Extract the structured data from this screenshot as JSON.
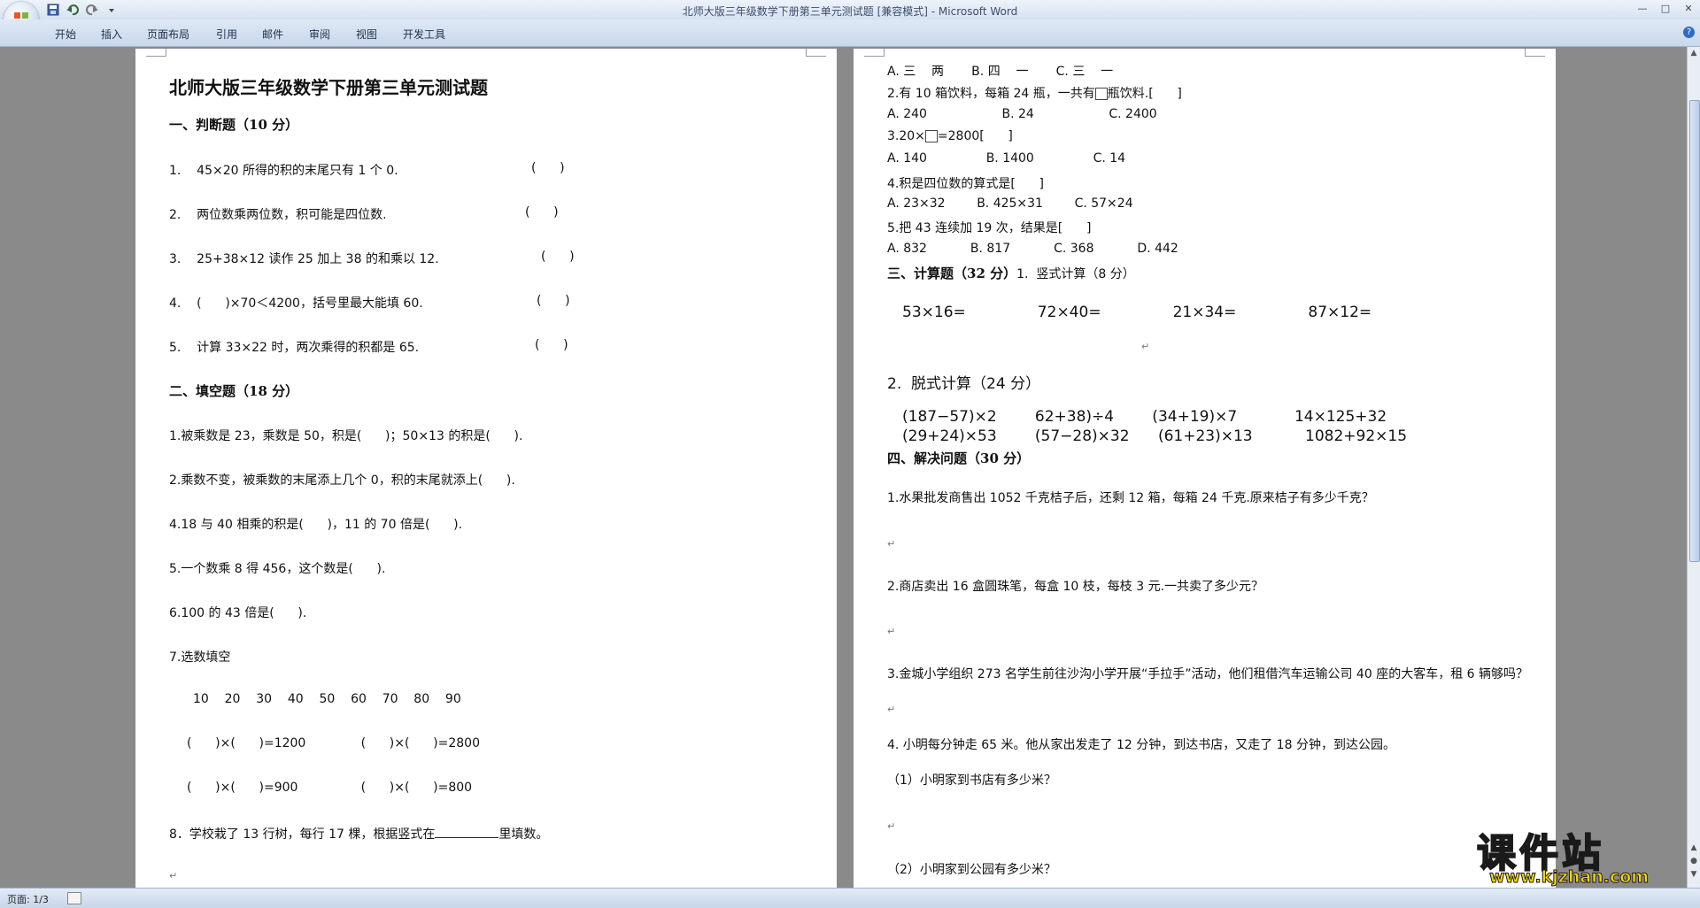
{
  "window": {
    "title": "北师大版三年级数学下册第三单元测试题 [兼容模式] - Microsoft Word",
    "controls": [
      "—",
      "□",
      "✕"
    ]
  },
  "ribbon": {
    "tabs": [
      "开始",
      "插入",
      "页面布局",
      "引用",
      "邮件",
      "审阅",
      "视图",
      "开发工具"
    ]
  },
  "status": {
    "page": "页面: 1/3"
  },
  "watermark": {
    "big": "课件站",
    "small": "www.kjzhan.com"
  },
  "page1": {
    "title": "北师大版三年级数学下册第三单元测试题",
    "s1_heading": "一、判断题（10 分）",
    "s1_items": [
      "1.    45×20 所得的积的末尾只有 1 个 0.",
      "2.    两位数乘两位数，积可能是四位数.",
      "3.    25+38×12 读作 25 加上 38 的和乘以 12.",
      "4.    (      )×70＜4200，括号里最大能填 60.",
      "5.    计算 33×22 时，两次乘得的积都是 65."
    ],
    "answer_paren": "(      )",
    "s2_heading": "二、填空题（18 分）",
    "s2_items": [
      "1.被乘数是 23，乘数是 50，积是(      )；50×13 的积是(      ).",
      "2.乘数不变，被乘数的末尾添上几个 0，积的末尾就添上(      ).",
      "4.18 与 40 相乘的积是(      )，11 的 70 倍是(      ).",
      "5.一个数乘 8 得 456，这个数是(      ).",
      "6.100 的 43 倍是(      ).",
      "7.选数填空"
    ],
    "numbers_row": "10    20    30    40    50    60    70    80    90",
    "fill_rows": [
      "(      )×(      )=1200              (      )×(      )=2800",
      "(      )×(      )=900                (      )×(      )=800"
    ],
    "item8_a": "8．学校栽了 13 行树，每行 17 棵，根据竖式在",
    "item8_b": "里填数。"
  },
  "page2": {
    "lines": {
      "q1_opts": "A. 三    两       B. 四    一       C. 三    一",
      "q2_a": "2.有 10 箱饮料，每箱 24 瓶，一共有",
      "q2_b": "瓶饮料.[      ]",
      "q2_opts": "A. 240                   B. 24                   C. 2400",
      "q3_a": "3.20×",
      "q3_b": "=2800[      ]",
      "q3_opts": "A. 140               B. 1400               C. 14",
      "q4": "4.积是四位数的算式是[      ]",
      "q4_opts": "A. 23×32        B. 425×31        C. 57×24",
      "q5": "5.把 43 连续加 19 次，结果是[      ]",
      "q5_opts": "A. 832           B. 817           C. 368           D. 442",
      "s3_heading": "三、计算题（32 分）",
      "s3_sub1": "1.  竖式计算（8 分）",
      "calc_row": "53×16=               72×40=               21×34=               87×12=",
      "s3_sub2": "2.  脱式计算（24 分）",
      "expr_row1": "(187−57)×2        62+38)÷4        (34+19)×7            14×125+32",
      "expr_row2": "(29+24)×53        (57−28)×32      (61+23)×13           1082+92×15",
      "s4_heading": "四、解决问题（30 分）",
      "p1": "1.水果批发商售出 1052 千克桔子后，还剩 12 箱，每箱 24 千克.原来桔子有多少千克？",
      "p2": "2.商店卖出 16 盒圆珠笔，每盒 10 枝，每枝 3 元.一共卖了多少元？",
      "p3": "3.金城小学组织 273 名学生前往沙沟小学开展“手拉手”活动，他们租借汽车运输公司 40 座的大客车，租 6 辆够吗？",
      "p4": "4. 小明每分钟走 65 米。他从家出发走了 12 分钟，到达书店，又走了 18 分钟，到达公园。",
      "p4_1": "（1）小明家到书店有多少米？",
      "p4_2": "（2）小明家到公园有多少米？"
    }
  },
  "paragraph_mark": "↵"
}
